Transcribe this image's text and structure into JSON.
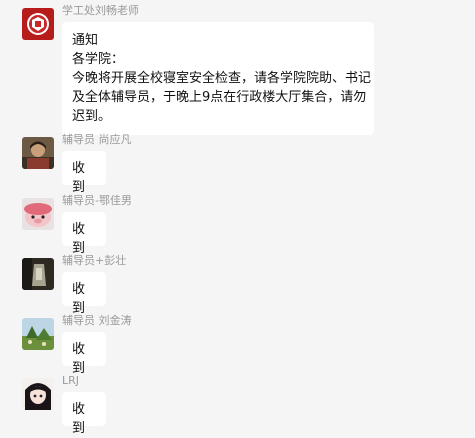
{
  "messages": [
    {
      "sender": "学工处刘畅老师",
      "avatar": "red-seal-avatar",
      "lines": [
        "通知",
        "各学院：",
        "今晚将开展全校寝室安全检查，请各学院院助、书记",
        "及全体辅导员，于晚上9点在行政楼大厅集合，请勿",
        "迟到。"
      ]
    },
    {
      "sender": "辅导员 尚应凡",
      "avatar": "photo-avatar-person",
      "text": "收到"
    },
    {
      "sender": "辅导员-鄂佳男",
      "avatar": "cartoon-pig-avatar",
      "text": "收到"
    },
    {
      "sender": "辅导员+彭壮",
      "avatar": "photo-avatar-object",
      "text": "收到"
    },
    {
      "sender": "辅导员 刘金涛",
      "avatar": "landscape-avatar",
      "text": "收到"
    },
    {
      "sender": "LRJ",
      "avatar": "anime-girl-avatar",
      "text": "收到"
    }
  ],
  "colors": {
    "background": "#f5f5f5",
    "bubble": "#ffffff",
    "sender_text": "#9a9a9a"
  }
}
